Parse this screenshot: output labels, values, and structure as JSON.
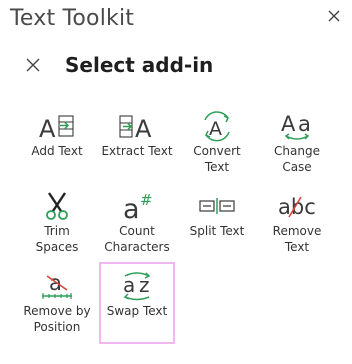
{
  "app": {
    "title": "Text Toolkit"
  },
  "panel": {
    "title": "Select add-in"
  },
  "colors": {
    "icon": "#3a3a3a",
    "accent_green": "#2e9e58",
    "accent_red": "#d9453b",
    "selected_border": "#f1b8ef"
  },
  "tiles": [
    {
      "icon": "add-text-icon",
      "lines": [
        "Add Text"
      ]
    },
    {
      "icon": "extract-text-icon",
      "lines": [
        "Extract Text"
      ]
    },
    {
      "icon": "convert-text-icon",
      "lines": [
        "Convert",
        "Text"
      ]
    },
    {
      "icon": "change-case-icon",
      "lines": [
        "Change",
        "Case"
      ]
    },
    {
      "icon": "trim-spaces-icon",
      "lines": [
        "Trim",
        "Spaces"
      ]
    },
    {
      "icon": "count-characters-icon",
      "lines": [
        "Count",
        "Characters"
      ]
    },
    {
      "icon": "split-text-icon",
      "lines": [
        "Split Text"
      ]
    },
    {
      "icon": "remove-text-icon",
      "lines": [
        "Remove",
        "Text"
      ]
    },
    {
      "icon": "remove-by-position-icon",
      "lines": [
        "Remove by",
        "Position"
      ]
    },
    {
      "icon": "swap-text-icon",
      "lines": [
        "Swap Text"
      ],
      "selected": true
    }
  ],
  "glyphs": {
    "add": "A",
    "extract": "A",
    "convert": "A",
    "case_upper": "A",
    "case_lower": "a",
    "count_a": "a",
    "count_hash": "#",
    "remove": "abc",
    "pos_a": "a",
    "swap_a": "a",
    "swap_z": "z"
  }
}
